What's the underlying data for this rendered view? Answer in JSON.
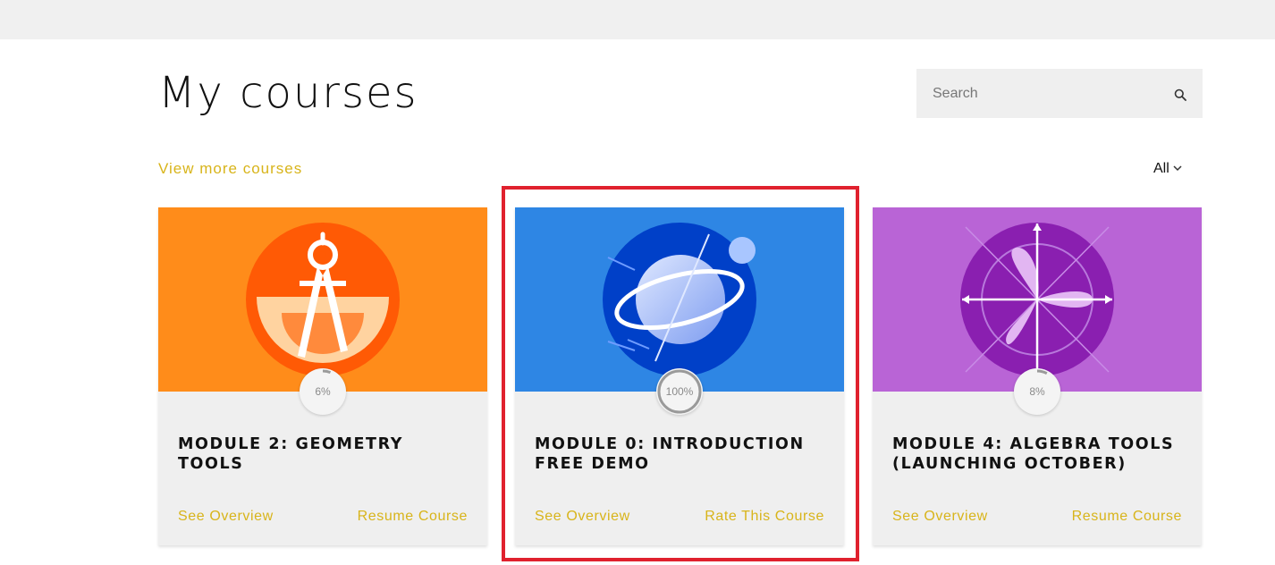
{
  "header": {
    "title": "My courses",
    "search": {
      "placeholder": "Search",
      "value": "",
      "icon": "search-icon"
    }
  },
  "toolbar": {
    "view_more": "View more courses",
    "filter_label": "All",
    "filter_icon": "chevron-down-icon"
  },
  "colors": {
    "accent_link": "#d8b41a",
    "highlight_border": "#e0212e",
    "card_orange": "#ff8c1a",
    "card_blue": "#2e86e4",
    "card_purple": "#b964d6"
  },
  "courses": [
    {
      "title": "MODULE 2: GEOMETRY TOOLS",
      "progress": "6%",
      "progress_value": 0.06,
      "banner_icon": "compass-icon",
      "link_left": "See Overview",
      "link_right": "Resume Course"
    },
    {
      "title": "MODULE 0: INTRODUCTION FREE DEMO",
      "progress": "100%",
      "progress_value": 1.0,
      "banner_icon": "planet-icon",
      "link_left": "See Overview",
      "link_right": "Rate This Course"
    },
    {
      "title": "MODULE 4: ALGEBRA TOOLS (LAUNCHING OCTOBER)",
      "progress": "8%",
      "progress_value": 0.08,
      "banner_icon": "polar-graph-icon",
      "link_left": "See Overview",
      "link_right": "Resume Course"
    }
  ]
}
